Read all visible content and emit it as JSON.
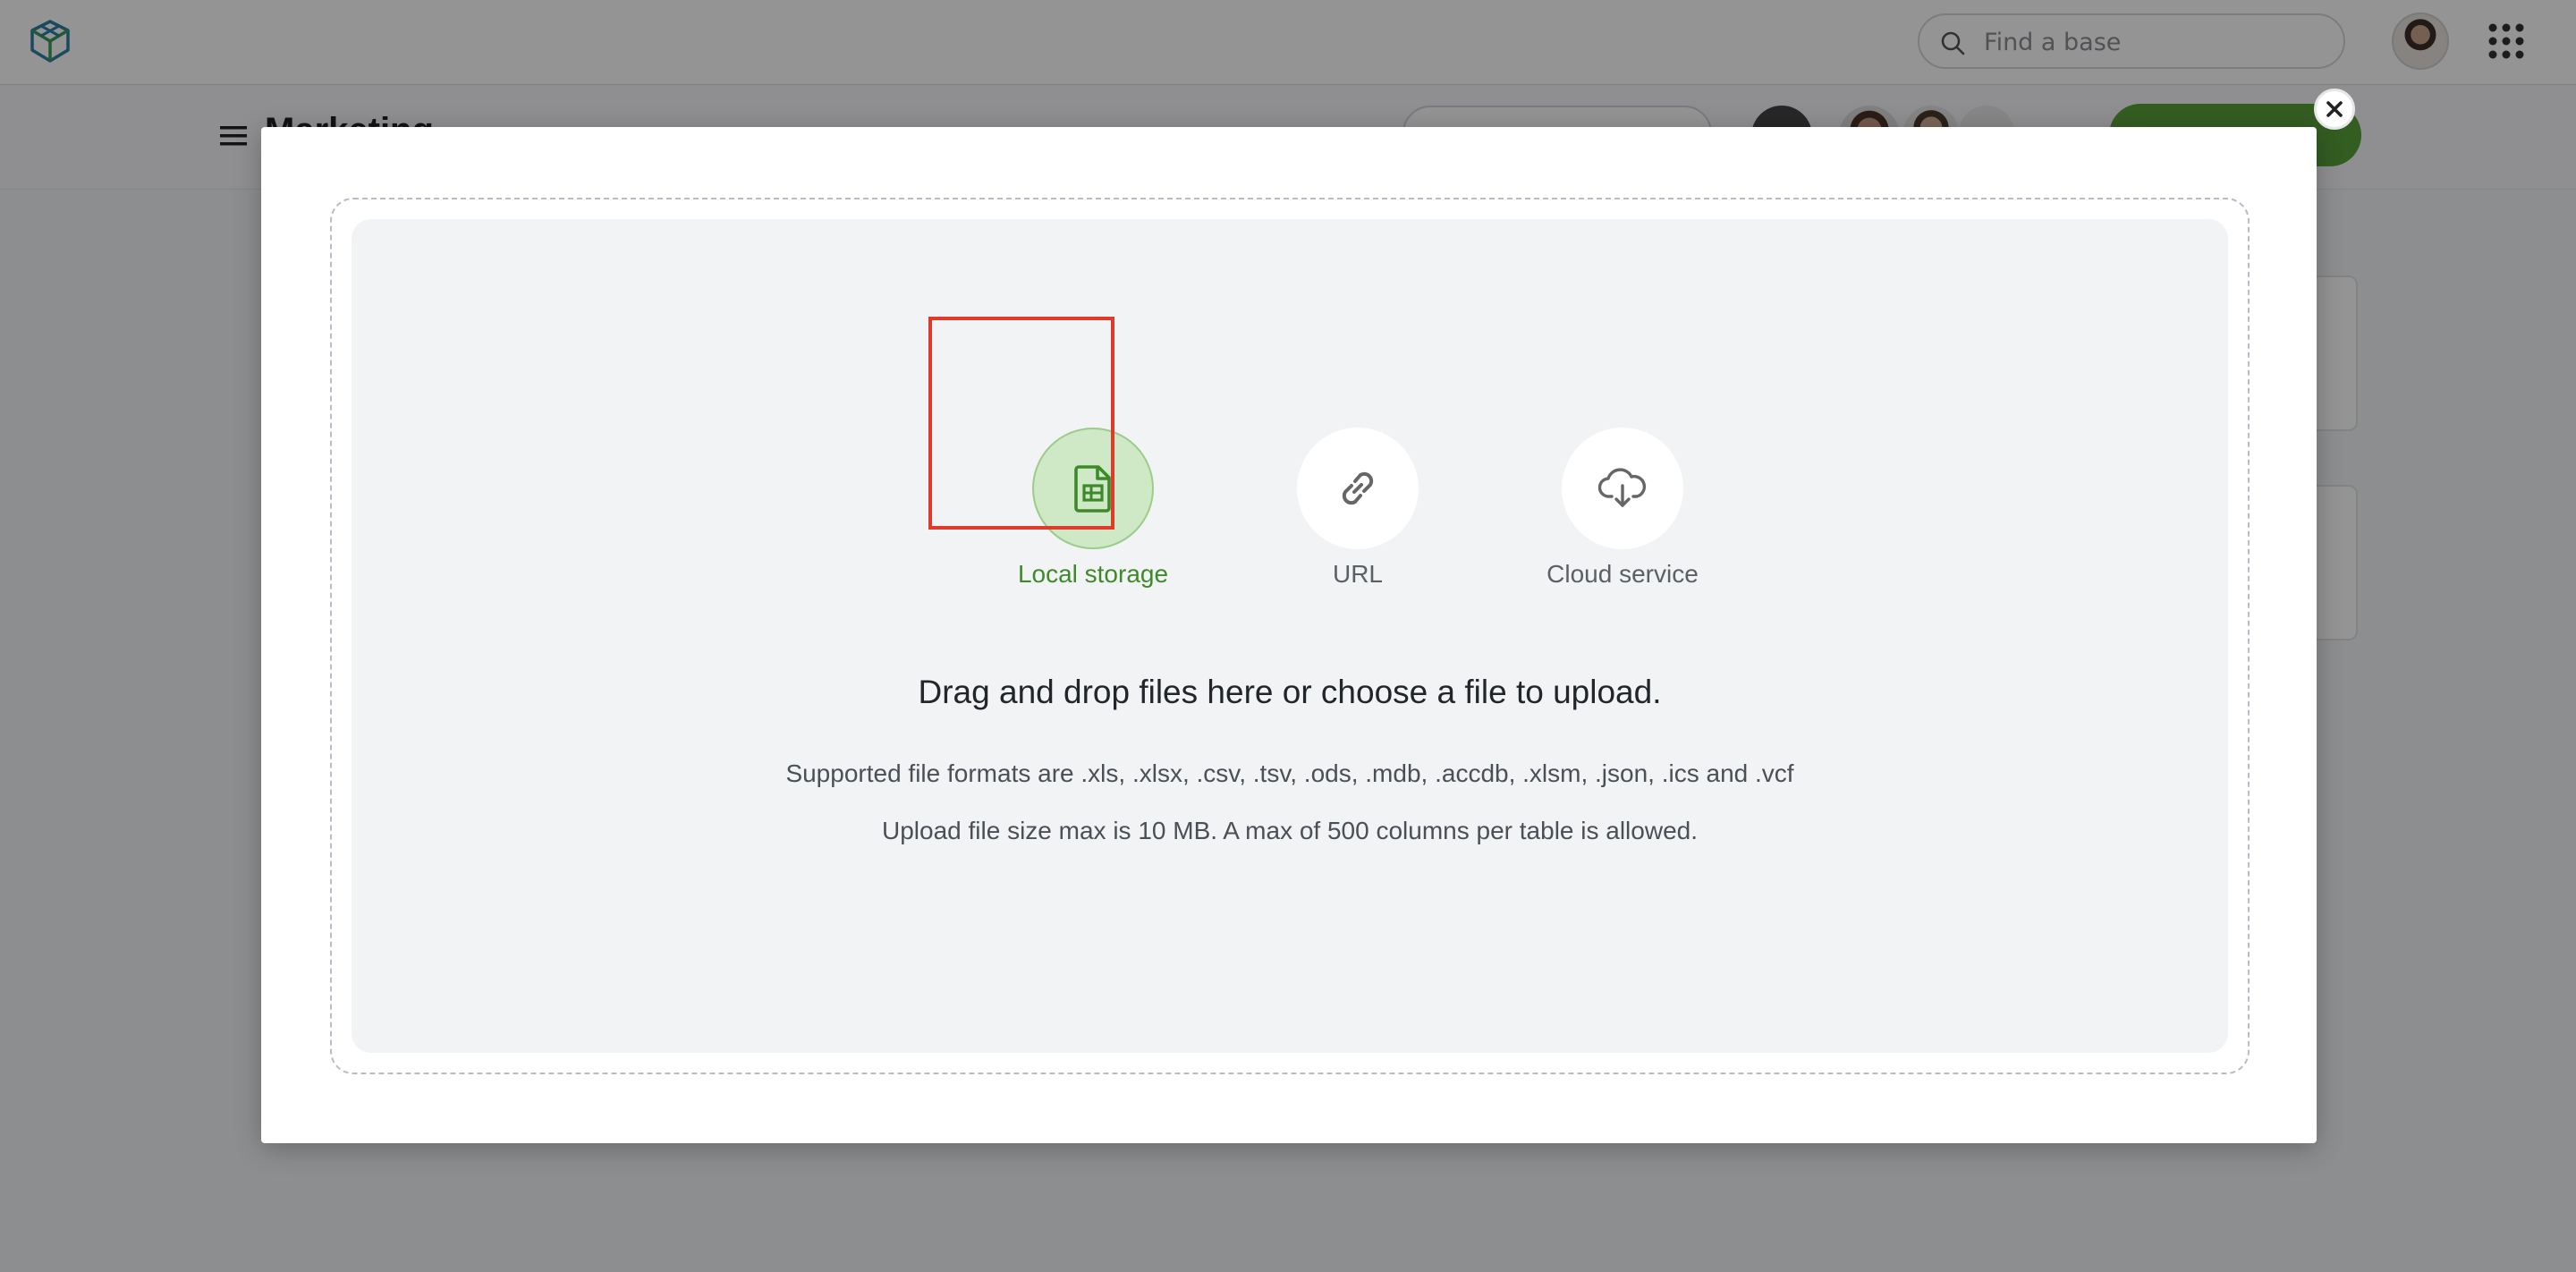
{
  "header": {
    "search_placeholder": "Find a base",
    "logo_icon": "cube-logo-icon",
    "apps_icon": "apps-grid-icon"
  },
  "base": {
    "title": "Marketing"
  },
  "modal": {
    "close_icon": "close-icon",
    "sources": [
      {
        "label": "Local storage",
        "icon": "spreadsheet-file-icon",
        "selected": true
      },
      {
        "label": "URL",
        "icon": "link-icon",
        "selected": false
      },
      {
        "label": "Cloud service",
        "icon": "cloud-download-icon",
        "selected": false
      }
    ],
    "headline": "Drag and drop files here or choose a file to upload.",
    "formats_text": "Supported file formats are .xls, .xlsx, .csv, .tsv, .ods, .mdb, .accdb, .xlsm, .json, .ics and .vcf",
    "limits_text": "Upload file size max is 10 MB. A max of 500 columns per table is allowed."
  },
  "colors": {
    "accent_green": "#5aa03c",
    "selected_label": "#3e8a2a",
    "highlight_red": "#e03a2a"
  }
}
